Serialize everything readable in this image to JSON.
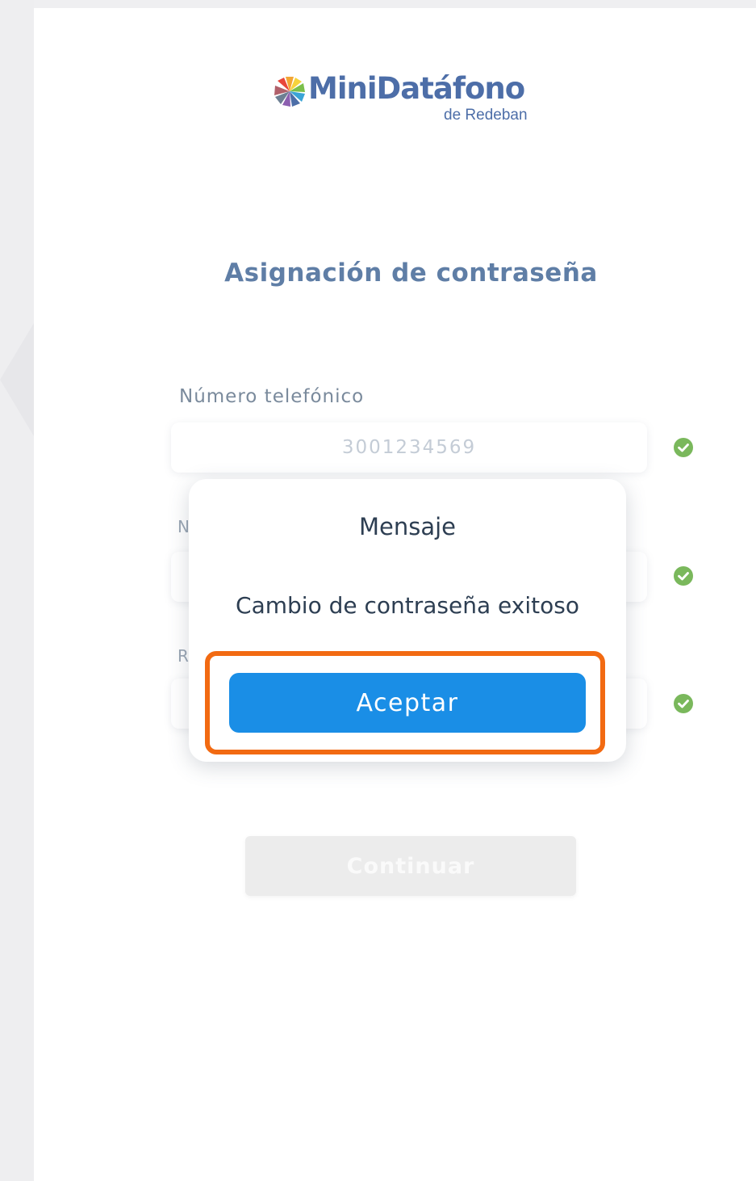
{
  "app": {
    "logo_name": "MiniDatáfono",
    "logo_subtitle": "de Redeban",
    "logo_colors": [
      "#e8473b",
      "#f3a534",
      "#f6d33c",
      "#7bbf4a",
      "#3aa4d6",
      "#4d6ea8",
      "#8c5fb0"
    ]
  },
  "form": {
    "title": "Asignación de contraseña",
    "fields": [
      {
        "label": "Número telefónico",
        "value": "3001234569",
        "valid": true
      },
      {
        "label_visible_fragment": "N",
        "value": "",
        "valid": true
      },
      {
        "label_visible_fragment": "R",
        "value": "",
        "valid": true
      }
    ],
    "continue_label": "Continuar",
    "continue_enabled": false
  },
  "dialog": {
    "title": "Mensaje",
    "message": "Cambio de contraseña exitoso",
    "accept_label": "Aceptar",
    "accept_highlighted": true
  },
  "colors": {
    "primary": "#1a8ee6",
    "brand_text": "#4d6ea8",
    "title_text": "#5f7ea6",
    "success": "#7ab85c",
    "highlight": "#f26a12",
    "disabled_button": "#ececec"
  },
  "icons": {
    "valid": "check-circle-icon",
    "logo": "minidatafono-logo-icon"
  }
}
